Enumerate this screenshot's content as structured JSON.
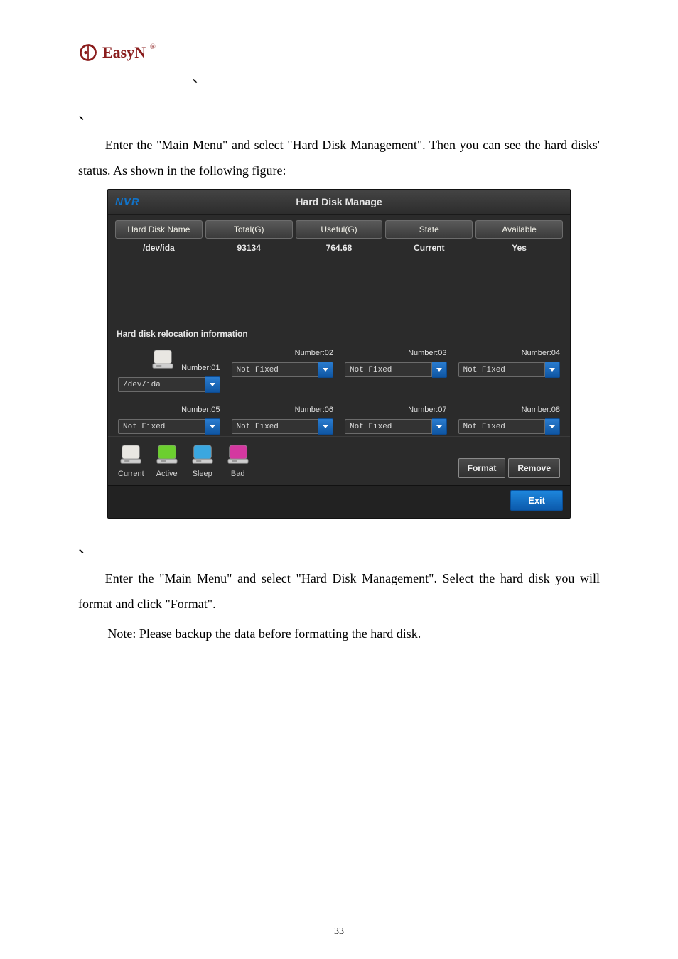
{
  "logo": {
    "text": "EasyN",
    "reg": "®"
  },
  "decor": {
    "tick": "、",
    "tick2": "、"
  },
  "para1": "Enter the \"Main Menu\" and select \"Hard Disk Management\". Then you can see the hard disks' status. As shown in the following figure:",
  "para2": "Enter the \"Main Menu\" and select \"Hard Disk Management\". Select the hard disk you will format and click \"Format\".",
  "note": "Note: Please backup the data before formatting the hard disk.",
  "page_number": "33",
  "window": {
    "brand": "NVR",
    "title": "Hard Disk Manage",
    "headers": [
      "Hard Disk Name",
      "Total(G)",
      "Useful(G)",
      "State",
      "Available"
    ],
    "row": [
      "/dev/ida",
      "93134",
      "764.68",
      "Current",
      "Yes"
    ],
    "section": "Hard disk relocation information",
    "slots": [
      {
        "label": "Number:01",
        "value": "/dev/ida",
        "has_icon": true
      },
      {
        "label": "Number:02",
        "value": "Not Fixed",
        "has_icon": false
      },
      {
        "label": "Number:03",
        "value": "Not Fixed",
        "has_icon": false
      },
      {
        "label": "Number:04",
        "value": "Not Fixed",
        "has_icon": false
      },
      {
        "label": "Number:05",
        "value": "Not Fixed",
        "has_icon": false
      },
      {
        "label": "Number:06",
        "value": "Not Fixed",
        "has_icon": false
      },
      {
        "label": "Number:07",
        "value": "Not Fixed",
        "has_icon": false
      },
      {
        "label": "Number:08",
        "value": "Not Fixed",
        "has_icon": false
      }
    ],
    "legend": [
      {
        "name": "Current",
        "color": "#e9e7e2"
      },
      {
        "name": "Active",
        "color": "#6ccf2f"
      },
      {
        "name": "Sleep",
        "color": "#3aa7e0"
      },
      {
        "name": "Bad",
        "color": "#d438a0"
      }
    ],
    "buttons": {
      "format": "Format",
      "remove": "Remove",
      "exit": "Exit"
    }
  }
}
